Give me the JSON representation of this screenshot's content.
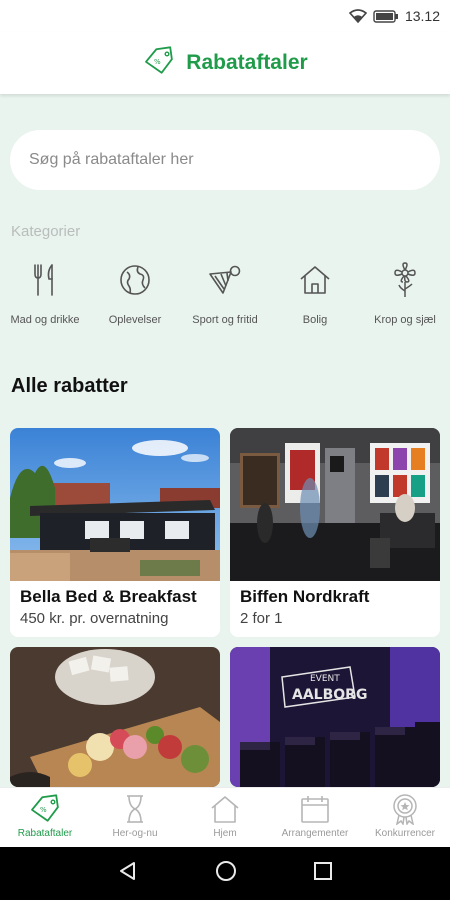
{
  "status": {
    "time": "13.12"
  },
  "header": {
    "title": "Rabataftaler",
    "icon": "tag-icon"
  },
  "search": {
    "placeholder": "Søg på rabataftaler her"
  },
  "categories": {
    "label": "Kategorier",
    "items": [
      {
        "label": "Mad og drikke",
        "icon": "utensils-icon"
      },
      {
        "label": "Oplevelser",
        "icon": "globe-icon"
      },
      {
        "label": "Sport og fritid",
        "icon": "shuttlecock-icon"
      },
      {
        "label": "Bolig",
        "icon": "house-icon"
      },
      {
        "label": "Krop og sjæl",
        "icon": "flower-icon"
      }
    ]
  },
  "deals": {
    "title": "Alle rabatter",
    "items": [
      {
        "title": "Bella Bed & Breakfast",
        "subtitle": "450 kr. pr. overnatning"
      },
      {
        "title": "Biffen Nordkraft",
        "subtitle": "2 for 1"
      },
      {
        "title": "",
        "subtitle": ""
      },
      {
        "title": "",
        "subtitle": "",
        "photo_text_1": "EVENT",
        "photo_text_2": "AALBORG"
      }
    ]
  },
  "nav": {
    "items": [
      {
        "label": "Rabataftaler",
        "icon": "tag-icon",
        "active": true
      },
      {
        "label": "Her-og-nu",
        "icon": "hourglass-icon",
        "active": false
      },
      {
        "label": "Hjem",
        "icon": "house-icon",
        "active": false
      },
      {
        "label": "Arrangementer",
        "icon": "calendar-icon",
        "active": false
      },
      {
        "label": "Konkurrencer",
        "icon": "award-icon",
        "active": false
      }
    ]
  },
  "colors": {
    "accent": "#1f9b4a",
    "background": "#eaf4ee",
    "inactive": "#9a9a9a"
  }
}
